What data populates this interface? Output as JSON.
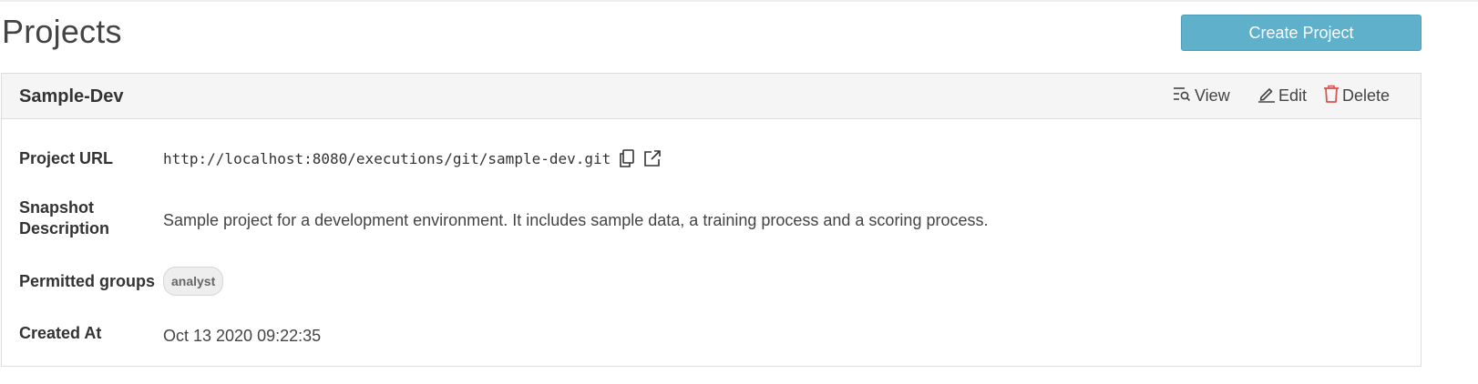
{
  "header": {
    "title": "Projects",
    "create_button_label": "Create Project"
  },
  "project": {
    "name": "Sample-Dev",
    "actions": {
      "view_label": "View",
      "edit_label": "Edit",
      "delete_label": "Delete"
    },
    "fields": {
      "url_label": "Project URL",
      "url_value": "http://localhost:8080/executions/git/sample-dev.git",
      "description_label": "Snapshot Description",
      "description_value": "Sample project for a development environment. It includes sample data, a training process and a scoring process.",
      "groups_label": "Permitted groups",
      "groups": [
        "analyst"
      ],
      "created_label": "Created At",
      "created_value": "Oct 13 2020 09:22:35"
    }
  },
  "icons": {
    "view": "search-list-icon",
    "edit": "pencil-icon",
    "delete": "trash-icon",
    "copy": "copy-icon",
    "open": "external-link-icon"
  },
  "colors": {
    "primary_button": "#5fb0cb",
    "delete_icon": "#d9534f",
    "card_header_bg": "#f5f5f5"
  }
}
